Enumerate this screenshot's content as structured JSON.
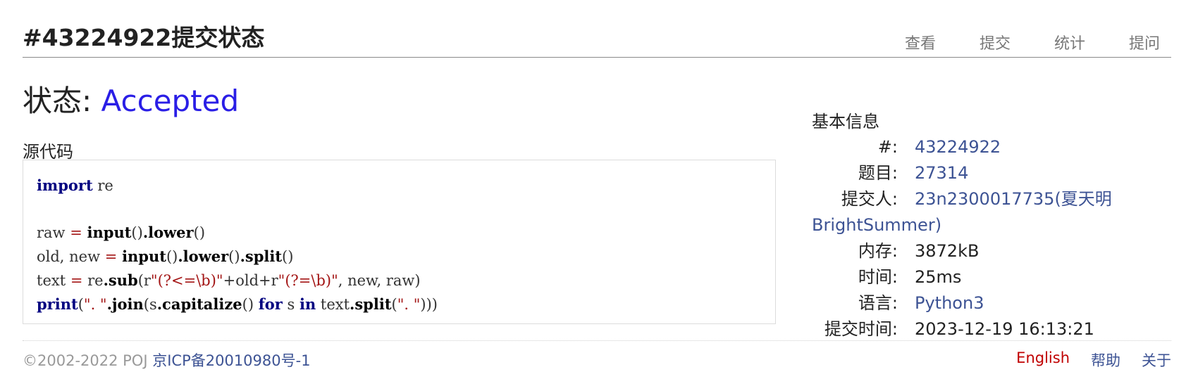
{
  "header": {
    "title": "#43224922提交状态",
    "nav": [
      "查看",
      "提交",
      "统计",
      "提问"
    ]
  },
  "status": {
    "label": "状态:",
    "value": "Accepted",
    "color": "#2a1ee6"
  },
  "source": {
    "label": "源代码",
    "code_lines": [
      "import re",
      "",
      "raw = input().lower()",
      "old, new = input().lower().split()",
      "text = re.sub(r\"(?<=\\b)\"+old+r\"(?=\\b)\", new, raw)",
      "print(\". \".join(s.capitalize() for s in text.split(\". \")))"
    ]
  },
  "info": {
    "title": "基本信息",
    "rows": [
      {
        "key": "#:",
        "value": "43224922",
        "link": true
      },
      {
        "key": "题目:",
        "value": "27314",
        "link": true
      },
      {
        "key": "提交人:",
        "value": "23n2300017735(夏天明",
        "value2": "BrightSummer)",
        "link": true
      },
      {
        "key": "内存:",
        "value": "3872kB",
        "link": false
      },
      {
        "key": "时间:",
        "value": "25ms",
        "link": false
      },
      {
        "key": "语言:",
        "value": "Python3",
        "link": true
      },
      {
        "key": "提交时间:",
        "value": "2023-12-19 16:13:21",
        "link": false
      }
    ]
  },
  "footer": {
    "copyright": "©2002-2022 POJ",
    "icp": "京ICP备20010980号-1",
    "links": [
      "English",
      "帮助",
      "关于"
    ]
  },
  "colors": {
    "link": "#3d5394",
    "accepted": "#2a1ee6",
    "english": "#c00000"
  }
}
